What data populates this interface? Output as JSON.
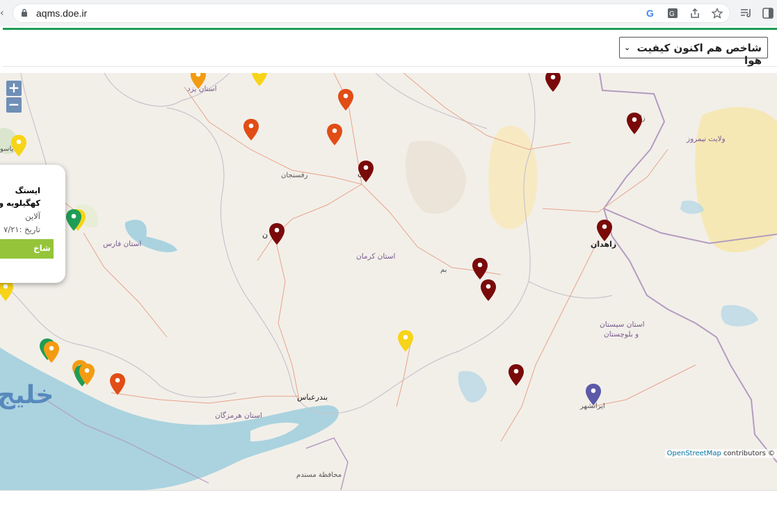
{
  "browser": {
    "url": "aqms.doe.ir"
  },
  "header": {
    "index_select_value": "شاخص هم اکنون کیفیت هوا"
  },
  "map": {
    "zoom_in": "+",
    "zoom_out": "−",
    "places": {
      "yazd_province": "استان یزد",
      "rafsanjan": "رفسنجان",
      "kerman_partial": "ن",
      "sirjan_partial": "ن",
      "fars_province": "استان فارس",
      "kerman_province": "استان کرمان",
      "bam": "بم",
      "zahedan": "زاهدان",
      "zabol_partial": "زا",
      "nimruz": "ولایت نیمروز",
      "sistan_line1": "استان سیستان",
      "sistan_line2": "و بلوچستان",
      "iranshahr": "ایرانشهر",
      "bandar_abbas": "بندرعباس",
      "hormozgan": "استان هرمزگان",
      "musandam": "محافظة مسندم",
      "yasuj_partial": "یاسو",
      "gulf_watermark": "خلیج"
    },
    "popup": {
      "title_line1": "ایستگ",
      "title_line2": "کهگیلویه و بو",
      "pollutant": "آلاین",
      "date": "تاریخ :۷/۲۱",
      "button": "شاخ"
    },
    "attribution_link": "OpenStreetMap",
    "attribution_text": " contributors ©",
    "marker_colors": {
      "good": "#1f9d55",
      "moderate": "#f7d417",
      "sensitive": "#f39c12",
      "unhealthy": "#e14d16",
      "hazardous": "#7a0a0a",
      "no_data": "#5c5aa8"
    }
  }
}
